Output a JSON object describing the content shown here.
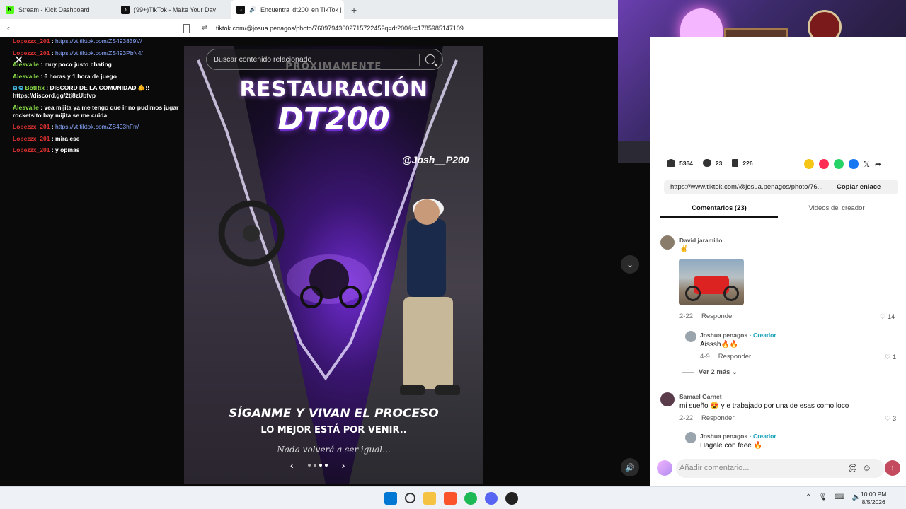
{
  "browser": {
    "tabs": [
      {
        "label": "Stream - Kick Dashboard",
        "icon": "kick-icon"
      },
      {
        "label": "(99+)TikTok - Make Your Day",
        "icon": "tiktok-icon"
      },
      {
        "label": "Encuentra 'dt200' en TikTok |",
        "icon": "tiktok-icon",
        "active": true
      }
    ],
    "new_tab": "+",
    "url": "tiktok.com/@josua.penagos/photo/7609794360271572245?q=dt200&t=1785985147109"
  },
  "chat": {
    "messages": [
      {
        "user": "Lopezzx_201",
        "color": "red",
        "text": "https://vt.tiktok.com/ZS493839V/",
        "is_link": true
      },
      {
        "user": "Lopezzx_201",
        "color": "red",
        "text": "https://vt.tiktok.com/ZS493PbN4/",
        "is_link": true
      },
      {
        "user": "Alesvalle",
        "color": "green",
        "text": "muy poco justo chating"
      },
      {
        "user": "Alesvalle",
        "color": "green",
        "text": "6 horas y 1 hora de juego"
      },
      {
        "user": "BotRix",
        "color": "green",
        "text": "DISCORD DE LA COMUNIDAD 🫵!! https://discord.gg/2tj8zUbfvp"
      },
      {
        "user": "Alesvalle",
        "color": "green",
        "text": "vea mijita ya me tengo que ir no pudimos jugar rocketsito bay mijita se me cuida"
      },
      {
        "user": "Lopezzx_201",
        "color": "red",
        "text": "https://vt.tiktok.com/ZS493hFrr/",
        "is_link": true
      },
      {
        "user": "Lopezzx_201",
        "color": "red",
        "text": "mira ese"
      },
      {
        "user": "Lopezzx_201",
        "color": "red",
        "text": "y opinas"
      }
    ]
  },
  "viewer": {
    "search_placeholder": "Buscar contenido relacionado",
    "photo_text": {
      "small": "PROXIMAMENTE",
      "line1": "RESTAURACIÓN",
      "line2": "DT200",
      "handle": "@Josh__P200",
      "tag1": "SÍGANME Y VIVAN EL PROCESO",
      "tag2": "LO MEJOR ESTÁ POR VENIR..",
      "tag3": "Nada volverá a ser igual..."
    },
    "carousel_dots": 4
  },
  "panel": {
    "stats": {
      "likes": "5364",
      "comments": "23",
      "saves": "226"
    },
    "link": "https://www.tiktok.com/@josua.penagos/photo/76...",
    "copy_label": "Copiar enlace",
    "tabs": [
      "Comentarios (23)",
      "Videos del creador"
    ],
    "comments": [
      {
        "user": "David jaramillo",
        "text": "✌️",
        "date": "2-22",
        "reply": "Responder",
        "likes": "14"
      },
      {
        "user": "Joshua penagos",
        "creator": "· Creador",
        "text": "Aisssh🔥🔥",
        "date": "4-9",
        "reply": "Responder",
        "likes": "1"
      },
      {
        "user": "Samael Garnet",
        "text": "mi sueño 😍 y e trabajado por una de esas como loco",
        "date": "2-22",
        "reply": "Responder",
        "likes": "3"
      },
      {
        "user": "Joshua penagos",
        "creator": "· Creador",
        "text": "Hagale con feee 🔥"
      }
    ],
    "more_replies": "Ver 2 más",
    "compose_placeholder": "Añadir comentario..."
  },
  "taskbar": {
    "time": "10:00 PM",
    "date": "8/5/2026"
  }
}
